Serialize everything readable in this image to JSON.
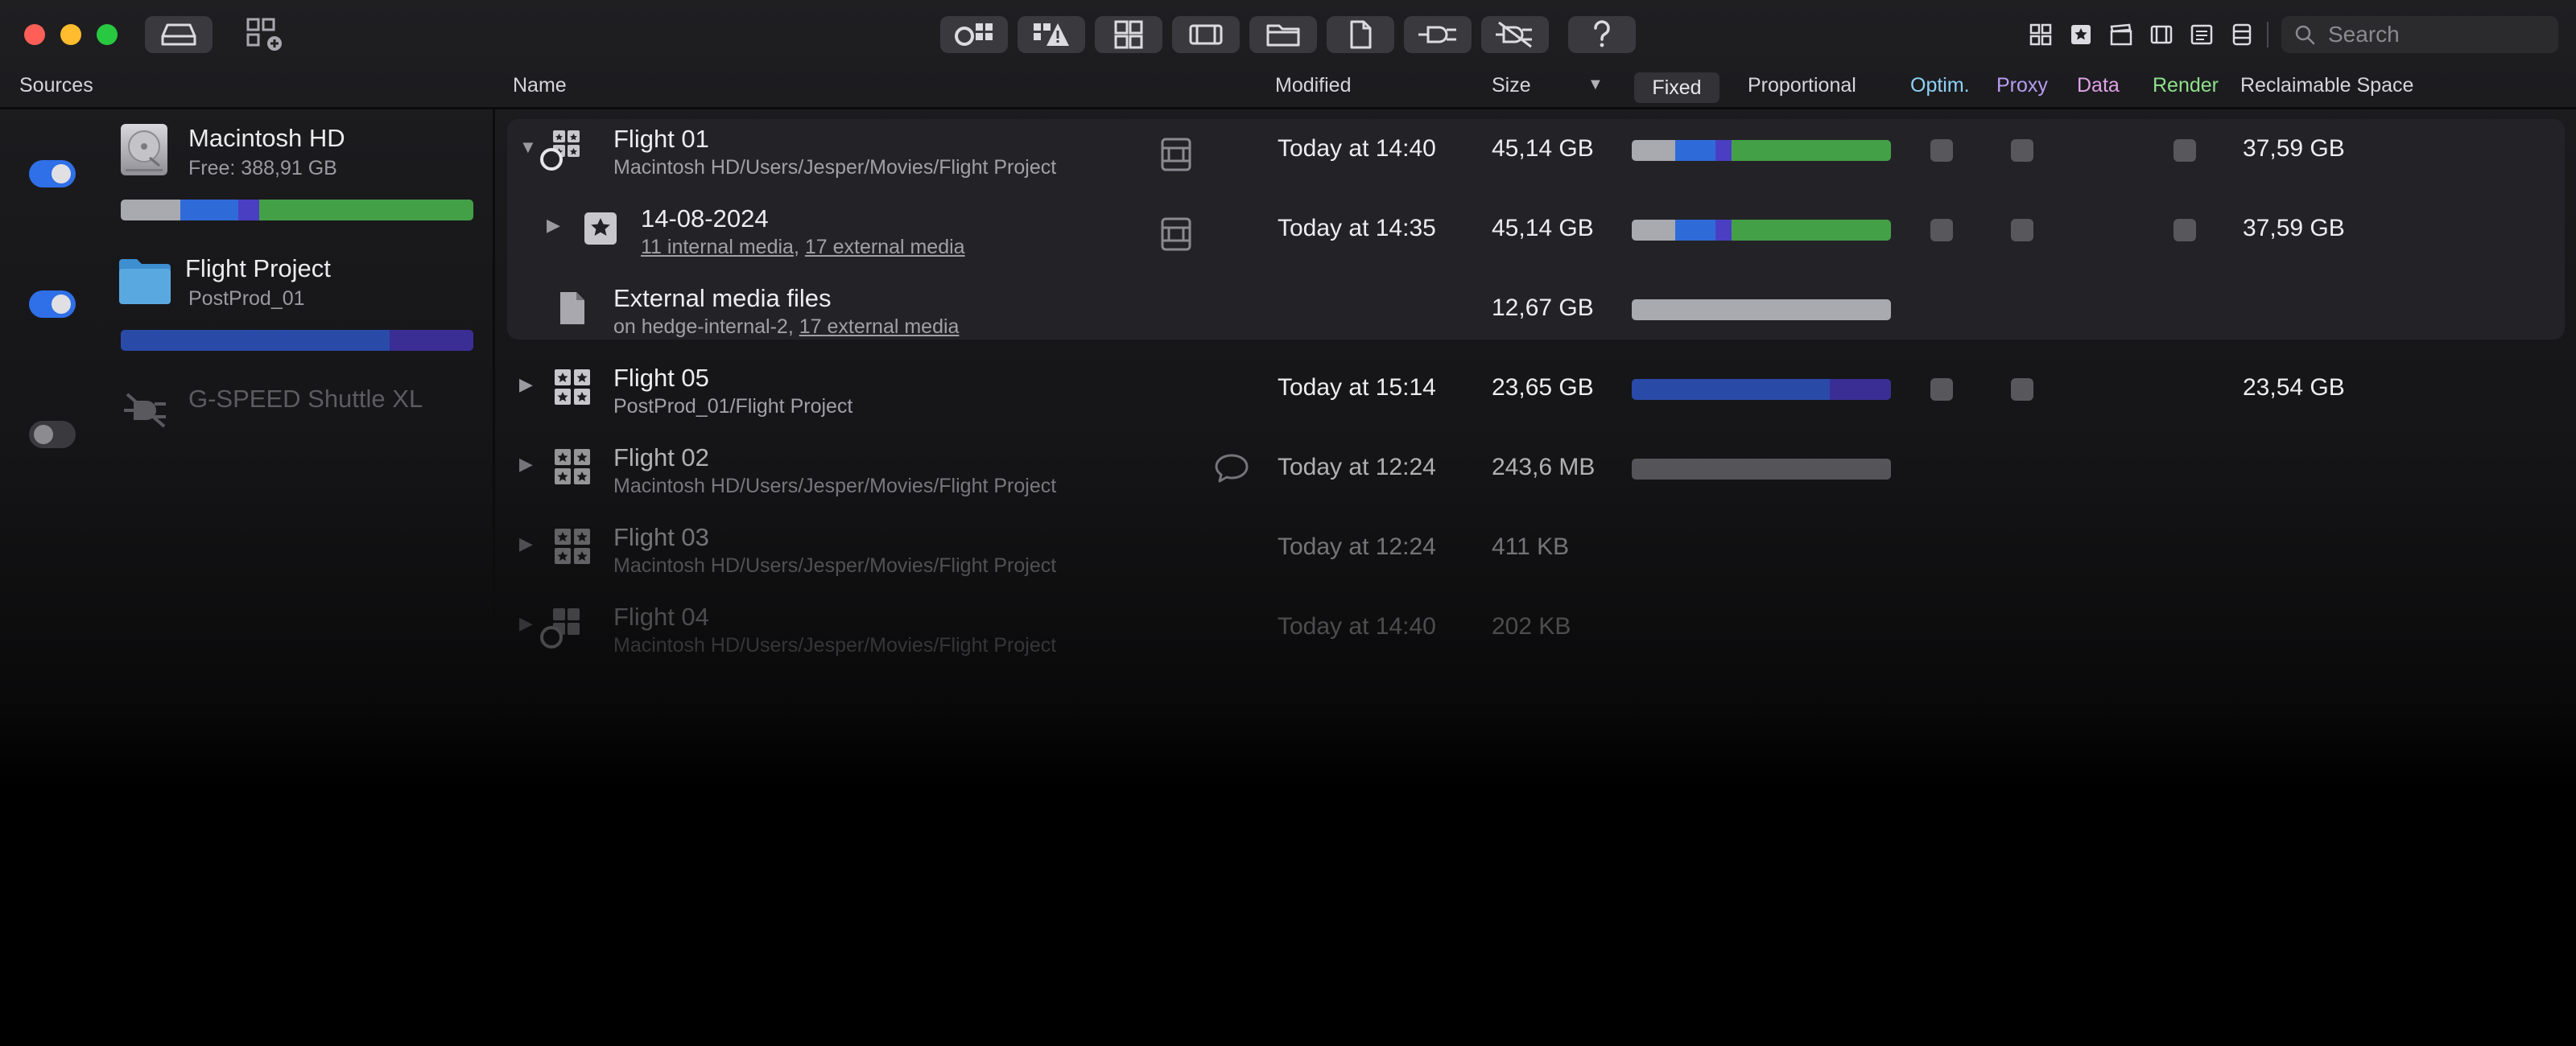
{
  "search": {
    "placeholder": "Search"
  },
  "headers": {
    "sources": "Sources",
    "name": "Name",
    "modified": "Modified",
    "size": "Size",
    "sort_glyph": "▼",
    "fixed": "Fixed",
    "proportional": "Proportional",
    "optim": "Optim.",
    "proxy": "Proxy",
    "data": "Data",
    "render": "Render",
    "reclaimable": "Reclaimable Space"
  },
  "colors": {
    "optim": "#8fd2f5",
    "proxy": "#b89cf0",
    "data": "#e0a2e6",
    "render": "#8fe08a",
    "bar_gray": "#a9a9b0",
    "bar_blue": "#2f6bd8",
    "bar_purple": "#4a3fc2",
    "bar_green": "#43a047",
    "bar_navy": "#2a4aa8",
    "bar_indigo": "#3a2e94",
    "bar_darkgray": "#6e6e74"
  },
  "sources": [
    {
      "title": "Macintosh HD",
      "subtitle": "Free: 388,91 GB",
      "icon": "hard-drive-icon",
      "enabled": true
    },
    {
      "title": "Flight Project",
      "subtitle": "PostProd_01",
      "icon": "folder-icon",
      "enabled": true
    },
    {
      "title": "G-SPEED Shuttle XL",
      "subtitle": "",
      "icon": "disconnected-plug-icon",
      "enabled": false
    }
  ],
  "rows": [
    {
      "title": "Flight 01",
      "subtitle": "Macintosh HD/Users/Jesper/Movies/Flight Project",
      "modified": "Today at 14:40",
      "size": "45,14 GB",
      "reclaimable": "37,59 GB",
      "disclosure": "▼"
    },
    {
      "title": "14-08-2024",
      "sub_link1": "11 internal media",
      "sub_sep": ", ",
      "sub_link2": "17 external media",
      "modified": "Today at 14:35",
      "size": "45,14 GB",
      "reclaimable": "37,59 GB",
      "disclosure": "▶"
    },
    {
      "title": "External media files",
      "sub_prefix": "on hedge-internal-2, ",
      "sub_link": "17 external media",
      "size": "12,67 GB"
    },
    {
      "title": "Flight 05",
      "subtitle": "PostProd_01/Flight Project",
      "modified": "Today at 15:14",
      "size": "23,65 GB",
      "reclaimable": "23,54 GB",
      "disclosure": "▶"
    },
    {
      "title": "Flight 02",
      "subtitle": "Macintosh HD/Users/Jesper/Movies/Flight Project",
      "modified": "Today at 12:24",
      "size": "243,6 MB",
      "disclosure": "▶"
    },
    {
      "title": "Flight 03",
      "subtitle": "Macintosh HD/Users/Jesper/Movies/Flight Project",
      "modified": "Today at 12:24",
      "size": "411 KB",
      "disclosure": "▶"
    },
    {
      "title": "Flight 04",
      "subtitle": "Macintosh HD/Users/Jesper/Movies/Flight Project",
      "modified": "Today at 14:40",
      "size": "202 KB",
      "disclosure": "▶"
    }
  ]
}
